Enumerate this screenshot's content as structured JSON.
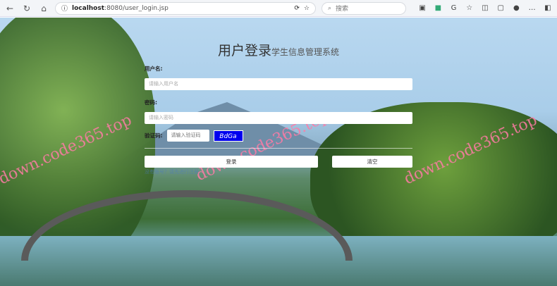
{
  "browser": {
    "url_host": "localhost",
    "url_rest": ":8080/user_login.jsp",
    "search_placeholder": "搜索"
  },
  "page": {
    "title": "用户登录",
    "subtitle": "学生信息管理系统",
    "username_label": "用户名:",
    "username_placeholder": "请输入用户名",
    "password_label": "密码:",
    "password_placeholder": "请输入密码",
    "captcha_label": "验证码:",
    "captcha_placeholder": "请输入验证码",
    "captcha_text": "BdGa",
    "login_button": "登录",
    "clear_button": "清空",
    "register_link": "没有账号？请先进行注册"
  },
  "watermark": "down.code365.top"
}
